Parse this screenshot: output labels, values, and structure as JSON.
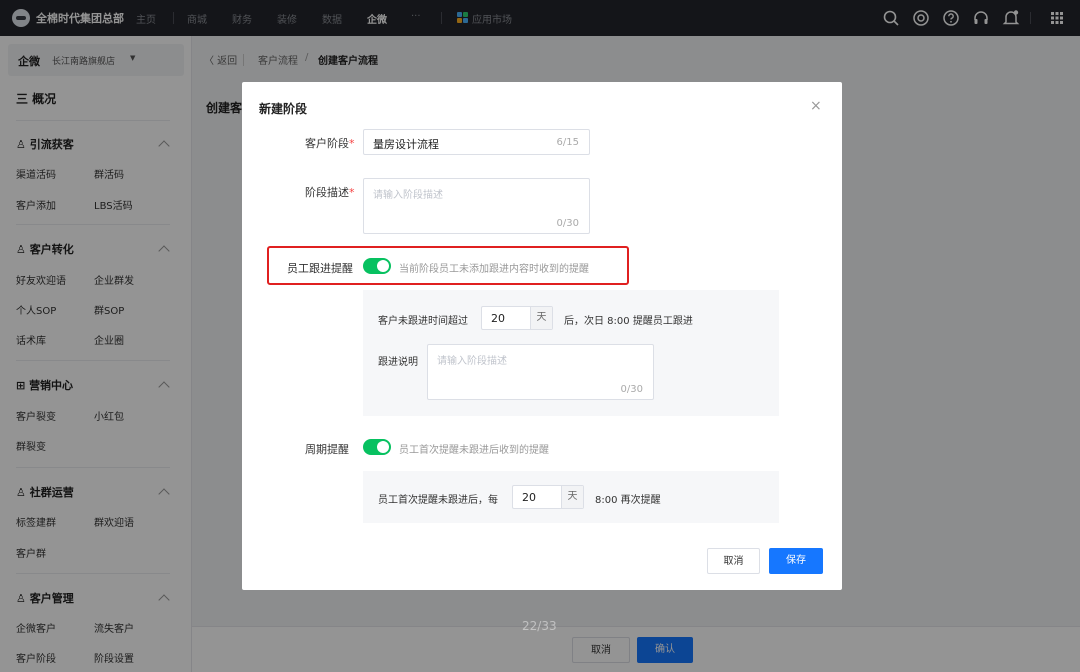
{
  "topbar": {
    "brand": "全棉时代集团总部",
    "nav": [
      "主页",
      "商城",
      "财务",
      "装修",
      "数据",
      "企微",
      "···"
    ],
    "app_market": "应用市场",
    "icons": [
      "search-icon",
      "target-icon",
      "help-icon",
      "headset-icon",
      "bell-icon",
      "grid-menu-icon"
    ]
  },
  "sidebar": {
    "title": "企微",
    "store": "长江南路旗舰店",
    "overview": "三 概况",
    "sections": [
      {
        "icon": "user-icon",
        "title": "引流获客",
        "items": [
          "渠道活码",
          "群活码",
          "客户添加",
          "LBS活码"
        ]
      },
      {
        "icon": "user-icon",
        "title": "客户转化",
        "items": [
          "好友欢迎语",
          "企业群发",
          "个人SOP",
          "群SOP",
          "话术库",
          "企业圈"
        ]
      },
      {
        "icon": "grid-icon",
        "title": "营销中心",
        "items": [
          "客户裂变",
          "小红包",
          "群裂变"
        ]
      },
      {
        "icon": "group-icon",
        "title": "社群运营",
        "items": [
          "标签建群",
          "群欢迎语",
          "客户群"
        ]
      },
      {
        "icon": "user-icon",
        "title": "客户管理",
        "items": [
          "企微客户",
          "流失客户",
          "客户阶段",
          "阶段设置"
        ]
      }
    ]
  },
  "main": {
    "back": "〈 返回",
    "crumb1": "客户流程",
    "crumb_sep": "/",
    "crumb2": "创建客户流程",
    "heading": "创建客",
    "cancel": "取消",
    "confirm": "确认",
    "page_number": "22/33"
  },
  "modal": {
    "title": "新建阶段",
    "close": "×",
    "stage_label": "客户阶段",
    "stage_value": "量房设计流程",
    "stage_count": "6/15",
    "desc_label": "阶段描述",
    "desc_placeholder": "请输入阶段描述",
    "desc_count": "0/30",
    "followup_label": "员工跟进提醒",
    "followup_on": true,
    "followup_hint": "当前阶段员工未添加跟进内容时收到的提醒",
    "no_followup_prefix": "客户未跟进时间超过",
    "no_followup_days": "20",
    "day_unit": "天",
    "no_followup_suffix": "后，次日 8:00 提醒员工跟进",
    "note_label": "跟进说明",
    "note_placeholder": "请输入阶段描述",
    "note_count": "0/30",
    "cycle_label": "周期提醒",
    "cycle_on": true,
    "cycle_hint": "员工首次提醒未跟进后收到的提醒",
    "cycle_prefix": "员工首次提醒未跟进后，每",
    "cycle_days": "20",
    "cycle_suffix": "8:00 再次提醒",
    "cancel": "取消",
    "save": "保存"
  },
  "colors": {
    "primary": "#1677ff",
    "toggle_on": "#07c160",
    "highlight": "#e02020",
    "topbar": "#23252b"
  }
}
